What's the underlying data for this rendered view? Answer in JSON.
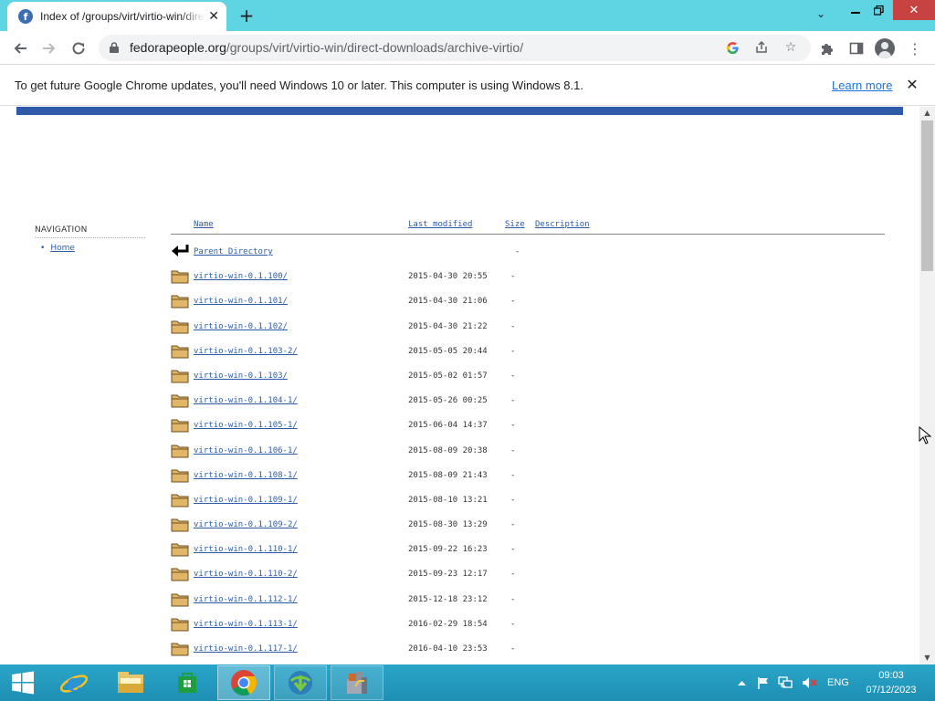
{
  "browser": {
    "tab_title": "Index of /groups/virt/virtio-win/direct-downloads/archive-virtio",
    "tab_favicon_letter": "f",
    "url_host": "fedorapeople.org",
    "url_path": "/groups/virt/virtio-win/direct-downloads/archive-virtio/",
    "icons": {
      "back": "back-arrow-icon",
      "forward": "forward-arrow-icon",
      "reload": "reload-icon",
      "lock": "lock-icon",
      "google": "google-icon",
      "share": "share-icon",
      "bookmark": "star-icon",
      "extensions": "puzzle-icon",
      "side_panel": "side-panel-icon",
      "profile": "profile-icon",
      "menu": "kebab-menu-icon"
    }
  },
  "infobar": {
    "message": "To get future Google Chrome updates, you'll need Windows 10 or later. This computer is using Windows 8.1.",
    "learn_more": "Learn more"
  },
  "page": {
    "accent_color": "#2d5ba8",
    "navigation": {
      "title": "NAVIGATION",
      "items": [
        {
          "label": "Home"
        }
      ]
    },
    "listing": {
      "headers": {
        "name": "Name",
        "last_modified": "Last modified",
        "size": "Size",
        "description": "Description"
      },
      "rows": [
        {
          "name": "Parent Directory",
          "date": "",
          "size": "-",
          "icon": "back-icon"
        },
        {
          "name": "virtio-win-0.1.100/",
          "date": "2015-04-30 20:55",
          "size": "-",
          "icon": "folder-icon"
        },
        {
          "name": "virtio-win-0.1.101/",
          "date": "2015-04-30 21:06",
          "size": "-",
          "icon": "folder-icon"
        },
        {
          "name": "virtio-win-0.1.102/",
          "date": "2015-04-30 21:22",
          "size": "-",
          "icon": "folder-icon"
        },
        {
          "name": "virtio-win-0.1.103-2/",
          "date": "2015-05-05 20:44",
          "size": "-",
          "icon": "folder-icon"
        },
        {
          "name": "virtio-win-0.1.103/",
          "date": "2015-05-02 01:57",
          "size": "-",
          "icon": "folder-icon"
        },
        {
          "name": "virtio-win-0.1.104-1/",
          "date": "2015-05-26 00:25",
          "size": "-",
          "icon": "folder-icon"
        },
        {
          "name": "virtio-win-0.1.105-1/",
          "date": "2015-06-04 14:37",
          "size": "-",
          "icon": "folder-icon"
        },
        {
          "name": "virtio-win-0.1.106-1/",
          "date": "2015-08-09 20:38",
          "size": "-",
          "icon": "folder-icon"
        },
        {
          "name": "virtio-win-0.1.108-1/",
          "date": "2015-08-09 21:43",
          "size": "-",
          "icon": "folder-icon"
        },
        {
          "name": "virtio-win-0.1.109-1/",
          "date": "2015-08-10 13:21",
          "size": "-",
          "icon": "folder-icon"
        },
        {
          "name": "virtio-win-0.1.109-2/",
          "date": "2015-08-30 13:29",
          "size": "-",
          "icon": "folder-icon"
        },
        {
          "name": "virtio-win-0.1.110-1/",
          "date": "2015-09-22 16:23",
          "size": "-",
          "icon": "folder-icon"
        },
        {
          "name": "virtio-win-0.1.110-2/",
          "date": "2015-09-23 12:17",
          "size": "-",
          "icon": "folder-icon"
        },
        {
          "name": "virtio-win-0.1.112-1/",
          "date": "2015-12-18 23:12",
          "size": "-",
          "icon": "folder-icon"
        },
        {
          "name": "virtio-win-0.1.113-1/",
          "date": "2016-02-29 18:54",
          "size": "-",
          "icon": "folder-icon"
        },
        {
          "name": "virtio-win-0.1.117-1/",
          "date": "2016-04-10 23:53",
          "size": "-",
          "icon": "folder-icon"
        },
        {
          "name": "",
          "date": "",
          "size": "",
          "icon": "folder-icon"
        }
      ]
    }
  },
  "taskbar": {
    "apps": [
      {
        "name": "start-button",
        "icon": "windows-logo-icon"
      },
      {
        "name": "internet-explorer",
        "icon": "internet-explorer-icon"
      },
      {
        "name": "file-explorer",
        "icon": "file-explorer-icon"
      },
      {
        "name": "store",
        "icon": "store-icon"
      },
      {
        "name": "chrome",
        "icon": "chrome-icon"
      },
      {
        "name": "download-manager",
        "icon": "download-manager-icon"
      },
      {
        "name": "installer",
        "icon": "installer-icon"
      }
    ],
    "tray": {
      "language": "ENG",
      "time": "09:03",
      "date": "07/12/2023"
    }
  }
}
